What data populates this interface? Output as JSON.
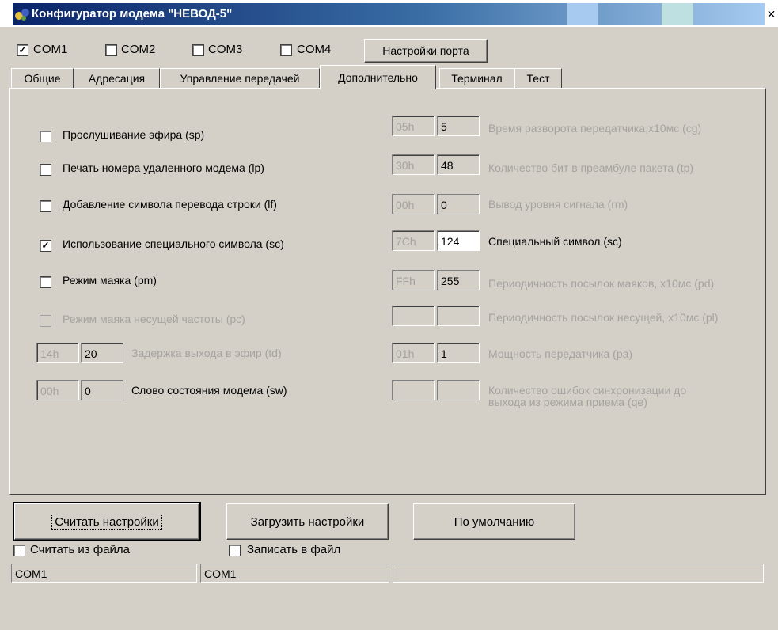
{
  "window": {
    "title": "Конфигуратор модема \"НЕВОД-5\"",
    "close_glyph": "×"
  },
  "ports": [
    {
      "label": "COM1",
      "checked": true
    },
    {
      "label": "COM2",
      "checked": false
    },
    {
      "label": "COM3",
      "checked": false
    },
    {
      "label": "COM4",
      "checked": false
    }
  ],
  "port_settings_label": "Настройки порта",
  "tabs": [
    "Общие",
    "Адресация",
    "Управление передачей",
    "Дополнительно",
    "Терминал",
    "Тест"
  ],
  "active_tab": "Дополнительно",
  "options": [
    {
      "label": "Прослушивание эфира (sp)",
      "checked": false,
      "enabled": true
    },
    {
      "label": "Печать номера удаленного модема (lp)",
      "checked": false,
      "enabled": true
    },
    {
      "label": "Добавление символа перевода строки (lf)",
      "checked": false,
      "enabled": true
    },
    {
      "label": "Использование специального символа (sc)",
      "checked": true,
      "enabled": true
    },
    {
      "label": "Режим маяка (pm)",
      "checked": false,
      "enabled": true
    },
    {
      "label": "Режим маяка несущей частоты (pc)",
      "checked": false,
      "enabled": false
    }
  ],
  "left_params": [
    {
      "hex": "14h",
      "value": "20",
      "label": "Задержка выхода в эфир (td)",
      "enabled": false
    },
    {
      "hex": "00h",
      "value": "0",
      "label": "Слово состояния модема (sw)",
      "enabled": true
    }
  ],
  "right_params": [
    {
      "hex": "05h",
      "value": "5",
      "label": "Время разворота передатчика,x10мс (cg)",
      "enabled": false
    },
    {
      "hex": "30h",
      "value": "48",
      "label": "Количество бит в преамбуле пакета (tp)",
      "enabled": false
    },
    {
      "hex": "00h",
      "value": "0",
      "label": "Вывод уровня сигнала (rm)",
      "enabled": false
    },
    {
      "hex": "7Ch",
      "value": "124",
      "label": "Специальный символ (sc)",
      "enabled": true
    },
    {
      "hex": "FFh",
      "value": "255",
      "label": "Периодичность посылок маяков, x10мс (pd)",
      "enabled": false
    },
    {
      "hex": "",
      "value": "",
      "label": "Периодичность посылок несущей, x10мс (pl)",
      "enabled": false
    },
    {
      "hex": "01h",
      "value": "1",
      "label": "Мощность передатчика (pa)",
      "enabled": false
    },
    {
      "hex": "",
      "value": "",
      "label": "Количество ошибок синхронизации до выхода из режима приема (qe)",
      "enabled": false
    }
  ],
  "buttons": {
    "read": "Считать настройки",
    "load": "Загрузить настройки",
    "default": "По умолчанию"
  },
  "file_options": [
    {
      "label": "Считать из файла",
      "checked": false
    },
    {
      "label": "Записать в файл",
      "checked": false
    }
  ],
  "status": [
    "COM1",
    "COM1",
    ""
  ]
}
